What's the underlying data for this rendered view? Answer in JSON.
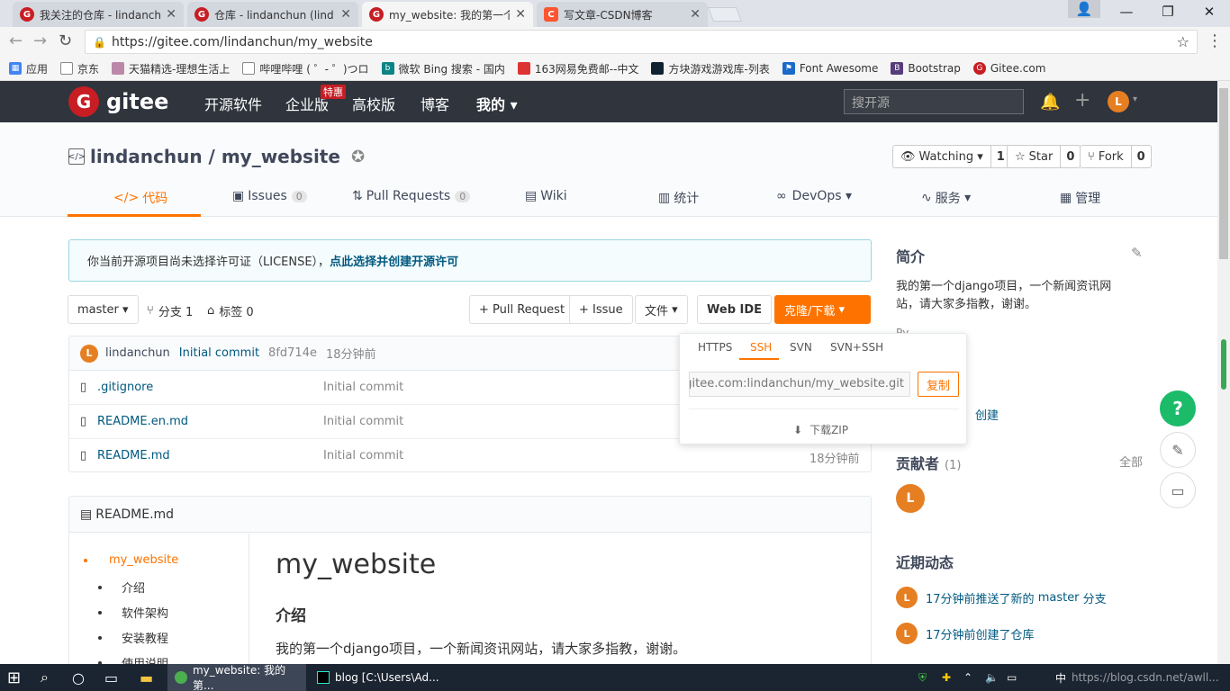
{
  "browser": {
    "tabs": [
      {
        "title": "我关注的仓库 - lindanch",
        "icon": "gitee-favicon-icon"
      },
      {
        "title": "仓库 - lindanchun (lind",
        "icon": "gitee-favicon-icon"
      },
      {
        "title": "my_website: 我的第一个",
        "icon": "gitee-favicon-icon",
        "active": true
      },
      {
        "title": "写文章-CSDN博客",
        "icon": "csdn-favicon-icon"
      }
    ],
    "url": "https://gitee.com/lindanchun/my_website",
    "bookmarks": [
      "应用",
      "京东",
      "天猫精选-理想生活上",
      "哔哩哔哩 ( ゜- ゜)つロ",
      "微软 Bing 搜索 - 国内",
      "163网易免费邮--中文",
      "方块游戏游戏库-列表",
      "Font Awesome",
      "Bootstrap",
      "Gitee.com"
    ]
  },
  "nav": {
    "logo": "gitee",
    "logo_mark": "G",
    "links": [
      "开源软件",
      "企业版",
      "高校版",
      "博客",
      "我的"
    ],
    "badge": "特惠",
    "search_placeholder": "搜开源",
    "avatar": "L"
  },
  "repo": {
    "owner": "lindanchun",
    "sep": " / ",
    "name": "my_website",
    "watch": {
      "label": "Watching",
      "count": "1"
    },
    "star": {
      "label": "Star",
      "count": "0"
    },
    "fork": {
      "label": "Fork",
      "count": "0"
    },
    "tabs": [
      {
        "label": "代码"
      },
      {
        "label": "Issues",
        "count": "0"
      },
      {
        "label": "Pull Requests",
        "count": "0"
      },
      {
        "label": "Wiki"
      },
      {
        "label": "统计"
      },
      {
        "label": "DevOps"
      },
      {
        "label": "服务"
      },
      {
        "label": "管理"
      }
    ]
  },
  "notice": {
    "text": "你当前开源项目尚未选择许可证（LICENSE），",
    "link": "点此选择并创建开源许可"
  },
  "toolbar": {
    "branch": "master",
    "branches": "分支 1",
    "tags": "标签 0",
    "pr": "+ Pull Request",
    "issue": "+ Issue",
    "file": "文件",
    "webide": "Web IDE",
    "clone": "克隆/下载"
  },
  "commit": {
    "avatar": "L",
    "author": "lindanchun",
    "message": "Initial commit",
    "hash": "8fd714e",
    "time": "18分钟前"
  },
  "files": [
    {
      "name": ".gitignore",
      "msg": "Initial commit",
      "time": ""
    },
    {
      "name": "README.en.md",
      "msg": "Initial commit",
      "time": ""
    },
    {
      "name": "README.md",
      "msg": "Initial commit",
      "time": "18分钟前"
    }
  ],
  "clone": {
    "tabs": [
      "HTTPS",
      "SSH",
      "SVN",
      "SVN+SSH"
    ],
    "active": "SSH",
    "value": "git@gitee.com:lindanchun/my_website.git",
    "copy": "复制",
    "zip": "下载ZIP"
  },
  "readme": {
    "filename": "README.md",
    "toc": [
      "my_website",
      "介绍",
      "软件架构",
      "安装教程",
      "使用说明"
    ],
    "h1": "my_website",
    "h2": "介绍",
    "p": "我的第一个django项目，一个新闻资讯网站，请大家多指教，谢谢。"
  },
  "sidebar": {
    "intro_title": "简介",
    "intro_text": "我的第一个django项目，一个新闻资讯网站，请大家多指教，谢谢。",
    "lang_fragment": "Py",
    "created": "创建",
    "contrib_title": "贡献者",
    "contrib_count": "(1)",
    "contrib_all": "全部",
    "contrib_avatar": "L",
    "activity_title": "近期动态",
    "activities": [
      {
        "avatar": "L",
        "pre": "17分钟前推送了新的 ",
        "branch": "master",
        "post": " 分支"
      },
      {
        "avatar": "L",
        "pre": "17分钟前创建了仓库",
        "branch": "",
        "post": ""
      }
    ]
  },
  "taskbar": {
    "items": [
      "my_website: 我的第...",
      "blog [C:\\Users\\Ad..."
    ],
    "ime": "中",
    "watermark": "https://blog.csdn.net/awll..."
  },
  "colors": {
    "brand": "#c71d23",
    "accent": "#fe7300",
    "nav_bg": "#2f343d"
  }
}
